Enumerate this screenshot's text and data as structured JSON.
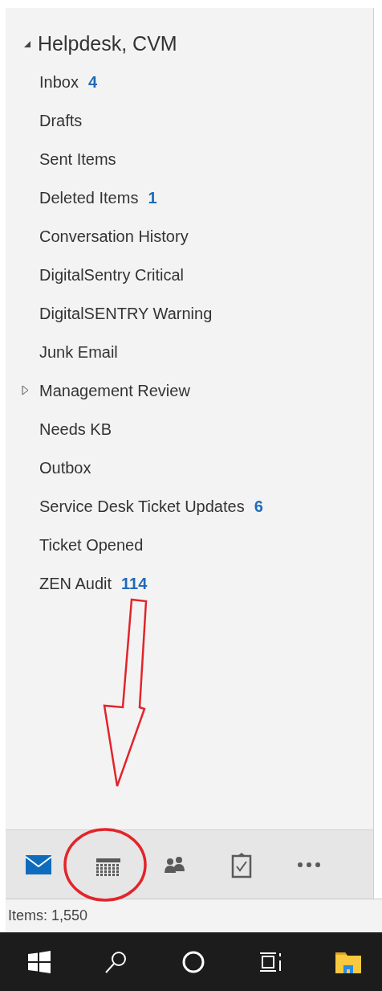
{
  "mailbox": {
    "name": "Helpdesk, CVM",
    "expanded": true
  },
  "folders": [
    {
      "name": "Inbox",
      "count": "4"
    },
    {
      "name": "Drafts"
    },
    {
      "name": "Sent Items"
    },
    {
      "name": "Deleted Items",
      "count": "1"
    },
    {
      "name": "Conversation History"
    },
    {
      "name": "DigitalSentry Critical"
    },
    {
      "name": "DigitalSENTRY Warning"
    },
    {
      "name": "Junk Email"
    },
    {
      "name": "Management Review",
      "kind": "group",
      "expanded": false
    },
    {
      "name": "Needs KB"
    },
    {
      "name": "Outbox"
    },
    {
      "name": "Service Desk Ticket Updates",
      "count": "6"
    },
    {
      "name": "Ticket Opened"
    },
    {
      "name": "ZEN Audit",
      "count": "114"
    }
  ],
  "nav": [
    {
      "kind": "mail",
      "selected": true
    },
    {
      "kind": "calendar",
      "selected": false
    },
    {
      "kind": "people",
      "selected": false
    },
    {
      "kind": "tasks",
      "selected": false
    },
    {
      "kind": "more",
      "selected": false
    }
  ],
  "status_bar": {
    "text": "Items: 1,550"
  },
  "taskbar": [
    {
      "kind": "start"
    },
    {
      "kind": "search"
    },
    {
      "kind": "cortana"
    },
    {
      "kind": "taskview"
    },
    {
      "kind": "explorer"
    }
  ]
}
